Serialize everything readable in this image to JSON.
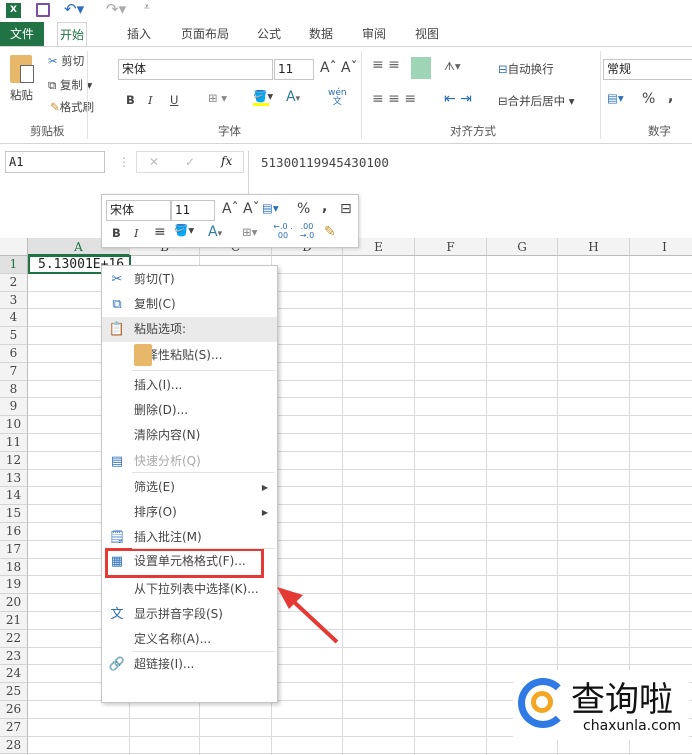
{
  "qat": {
    "app_icon": "excel-icon",
    "save_icon": "save-icon",
    "undo_icon": "undo-icon",
    "redo_icon": "redo-icon",
    "customize_icon": "customize-icon"
  },
  "tabs": [
    "文件",
    "开始",
    "插入",
    "页面布局",
    "公式",
    "数据",
    "审阅",
    "视图"
  ],
  "ribbon": {
    "paste": "粘贴",
    "cut": "剪切",
    "copy": "复制",
    "format_painter": "格式刷",
    "clipboard_group": "剪贴板",
    "font_name": "宋体",
    "font_size": "11",
    "bold": "B",
    "italic": "I",
    "underline": "U",
    "phonetic": "wén",
    "phonetic2": "文",
    "font_group": "字体",
    "wrap_text": "自动换行",
    "merge_center": "合并后居中",
    "alignment_group": "对齐方式",
    "number_format": "常规",
    "percent": "%",
    "comma": ",",
    "number_group": "数字",
    "highlight_color": "#9fd5b7",
    "fill_color": "#ffff00",
    "font_color": "#2a7a9e"
  },
  "formula_bar": {
    "name_box": "A1",
    "cancel": "✕",
    "enter": "✓",
    "fx": "fx",
    "value": "51300119945430100"
  },
  "mini_toolbar": {
    "font_name": "宋体",
    "font_size": "11",
    "percent": "%",
    "comma": ",",
    "bold": "B",
    "italic": "I",
    "inc_decimal": "←.0 .00",
    "dec_decimal": ".00 →.0"
  },
  "grid": {
    "columns": [
      "A",
      "B",
      "C",
      "D",
      "E",
      "F",
      "G",
      "H",
      "I"
    ],
    "rows": 28,
    "a1_value": "5.13001E+16",
    "selected": "A1",
    "accent": "#217346"
  },
  "context_menu": {
    "items": [
      {
        "label": "剪切(T)",
        "icon": "scissors-icon"
      },
      {
        "label": "复制(C)",
        "icon": "copy-icon"
      },
      {
        "label": "粘贴选项:",
        "icon": "paste-icon"
      },
      {
        "label": "选择性粘贴(S)..."
      },
      {
        "label": "插入(I)..."
      },
      {
        "label": "删除(D)..."
      },
      {
        "label": "清除内容(N)"
      },
      {
        "label": "快速分析(Q)",
        "icon": "quick-analysis-icon",
        "disabled": true
      },
      {
        "label": "筛选(E)",
        "submenu": true
      },
      {
        "label": "排序(O)",
        "submenu": true
      },
      {
        "label": "插入批注(M)",
        "icon": "comment-icon"
      },
      {
        "label": "设置单元格格式(F)...",
        "icon": "format-cells-icon",
        "highlighted": true
      },
      {
        "label": "从下拉列表中选择(K)..."
      },
      {
        "label": "显示拼音字段(S)",
        "icon": "phonetic-icon"
      },
      {
        "label": "定义名称(A)..."
      },
      {
        "label": "超链接(I)...",
        "icon": "hyperlink-icon"
      }
    ],
    "highlight_color": "#e53935"
  },
  "watermark": {
    "name": "查询啦",
    "url": "chaxunla.com"
  }
}
